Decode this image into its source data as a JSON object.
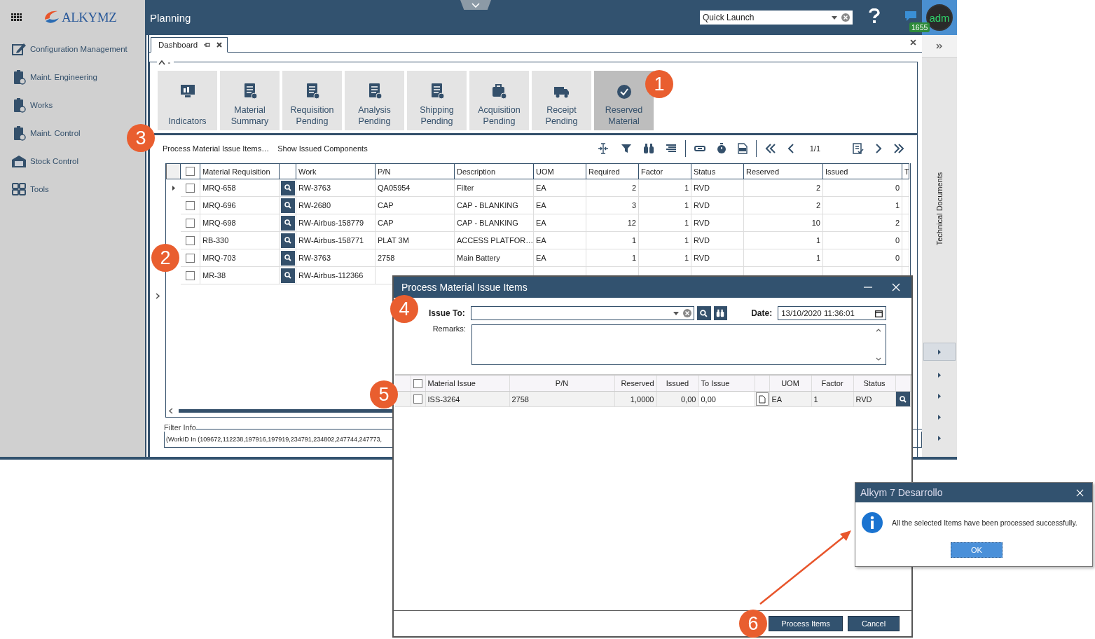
{
  "app": {
    "logo": "ALKYMZ",
    "module_title": "Planning"
  },
  "sidebar": {
    "items": [
      {
        "label": "Configuration Management"
      },
      {
        "label": "Maint. Engineering"
      },
      {
        "label": "Works"
      },
      {
        "label": "Maint. Control"
      },
      {
        "label": "Stock Control"
      },
      {
        "label": "Tools"
      }
    ]
  },
  "header": {
    "quick_launch": {
      "value": "Quick Launch"
    },
    "notification_count": "1655",
    "avatar": "adm"
  },
  "tabs": [
    {
      "label": "Dashboard",
      "selected": true
    }
  ],
  "tiles": [
    {
      "label": "Indicators",
      "selected": false
    },
    {
      "label": "Material Summary",
      "selected": false
    },
    {
      "label": "Requisition Pending",
      "selected": false
    },
    {
      "label": "Analysis Pending",
      "selected": false
    },
    {
      "label": "Shipping Pending",
      "selected": false
    },
    {
      "label": "Acquisition Pending",
      "selected": false
    },
    {
      "label": "Receipt Pending",
      "selected": false
    },
    {
      "label": "Reserved Material",
      "selected": true
    }
  ],
  "toolbar": {
    "actions": [
      "Process Material Issue Items…",
      "Show Issued Components"
    ],
    "page": "1/1"
  },
  "table": {
    "columns": [
      "Material Requisition",
      "Work",
      "P/N",
      "Description",
      "UOM",
      "Required",
      "Factor",
      "Status",
      "Reserved",
      "Issued",
      "T"
    ],
    "rows": [
      {
        "current": true,
        "checked": false,
        "cells": [
          "MRQ-658",
          "RW-3763",
          "QA05954",
          "Filter",
          "EA",
          "2",
          "1",
          "RVD",
          "2",
          "0"
        ]
      },
      {
        "current": false,
        "checked": false,
        "cells": [
          "MRQ-696",
          "RW-2680",
          "CAP",
          "CAP - BLANKING",
          "EA",
          "3",
          "1",
          "RVD",
          "2",
          "1"
        ]
      },
      {
        "current": false,
        "checked": false,
        "cells": [
          "MRQ-698",
          "RW-Airbus-158779",
          "CAP",
          "CAP - BLANKING",
          "EA",
          "12",
          "1",
          "RVD",
          "10",
          "2"
        ]
      },
      {
        "current": false,
        "checked": false,
        "cells": [
          "RB-330",
          "RW-Airbus-158771",
          "PLAT 3M",
          "ACCESS PLATFOR…",
          "EA",
          "1",
          "1",
          "RVD",
          "1",
          "0"
        ]
      },
      {
        "current": false,
        "checked": false,
        "cells": [
          "MRQ-703",
          "RW-3763",
          "2758",
          "Main Battery",
          "EA",
          "1",
          "1",
          "RVD",
          "1",
          "0"
        ]
      },
      {
        "current": false,
        "checked": false,
        "cells": [
          "MR-38",
          "RW-Airbus-112366"
        ]
      }
    ],
    "all_checked": false
  },
  "filter_info": {
    "label": "Filter Info",
    "text": "(WorkID In (109672,112238,197916,197919,234791,234802,247744,247773,"
  },
  "right_panel": {
    "label": "Technical Documents"
  },
  "dialog": {
    "title": "Process Material Issue Items",
    "issue_to_label": "Issue To:",
    "date_label": "Date:",
    "date_value": "13/10/2020 11:36:01",
    "remarks_label": "Remarks:",
    "columns": [
      "Material Issue",
      "P/N",
      "Reserved",
      "Issued",
      "To Issue",
      "UOM",
      "Factor",
      "Status"
    ],
    "rows": [
      {
        "checked": false,
        "cells": [
          "ISS-3264",
          "2758",
          "1,0000",
          "0,00",
          "0,00",
          "EA",
          "1",
          "RVD"
        ]
      }
    ],
    "all_checked": false,
    "buttons": [
      "Process Items",
      "Cancel"
    ]
  },
  "message_box": {
    "title": "Alkym 7 Desarrollo",
    "text": "All the selected Items have been processed successfully.",
    "button": "OK"
  },
  "callouts": [
    "1",
    "2",
    "3",
    "4",
    "5",
    "6"
  ]
}
